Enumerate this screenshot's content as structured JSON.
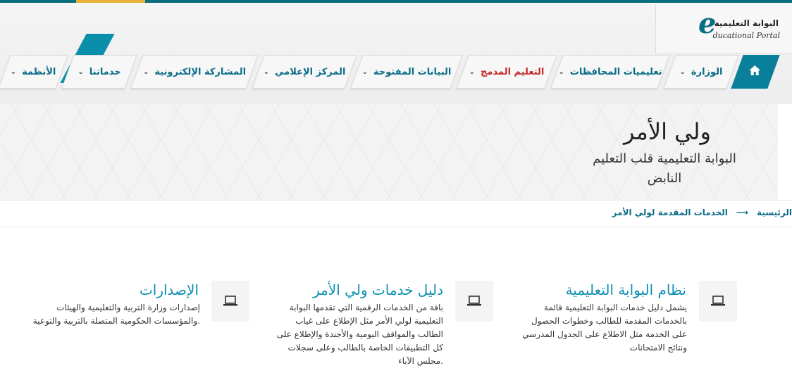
{
  "logo": {
    "letter": "e",
    "arabic": "البوابة التعليمية",
    "english": "ducational Portal"
  },
  "nav": {
    "items": [
      {
        "label": "الوزارة"
      },
      {
        "label": "تعليميات المحافظات"
      },
      {
        "label": "التعليم المدمج",
        "active": true
      },
      {
        "label": "البيانات المفتوحة"
      },
      {
        "label": "المركز الإعلامي"
      },
      {
        "label": "المشاركة الإلكترونية"
      },
      {
        "label": "خدماتنا"
      },
      {
        "label": "الأنظمة"
      }
    ],
    "chevron": "⌄"
  },
  "banner": {
    "title": "ولي الأمر",
    "subtitle": "البوابة التعليمية قلب التعليم النابض"
  },
  "breadcrumb": {
    "home": "الرئيسية",
    "arrow": "⟶",
    "current": "الخدمات المقدمة لولي الأمر"
  },
  "cards": [
    {
      "title": "نظام البوابة التعليمية",
      "text": "يشمل دليل خدمات البوابة التعليمية قائمة بالخدمات المقدمة للطالب وخطوات الحصول على الخدمة مثل الاطلاع على الجدول المدرسي ونتائج الامتحانات",
      "icon": "laptop-icon"
    },
    {
      "title": "دليل خدمات ولي الأمر",
      "text": "باقة من الخدمات الرقمية التي تقدمها البوابة التعليمية لولي الأمر مثل الإطلاع على غياب الطالب والمواقف اليومية والأجندة والإطلاع على كل التطبيقات الخاصة بالطالب وعلى سجلات مجلس الآباء.",
      "icon": "laptop-icon"
    },
    {
      "title": "الإصدارات",
      "text": "إصدارات وزارة التربية والتعليمية والهيئات والمؤسسات الحكومية المتصلة بالتربية والتوعية.",
      "icon": "laptop-icon"
    }
  ],
  "colors": {
    "accent": "#0a6d88",
    "active": "#c62828",
    "top": "#0b6e80"
  }
}
